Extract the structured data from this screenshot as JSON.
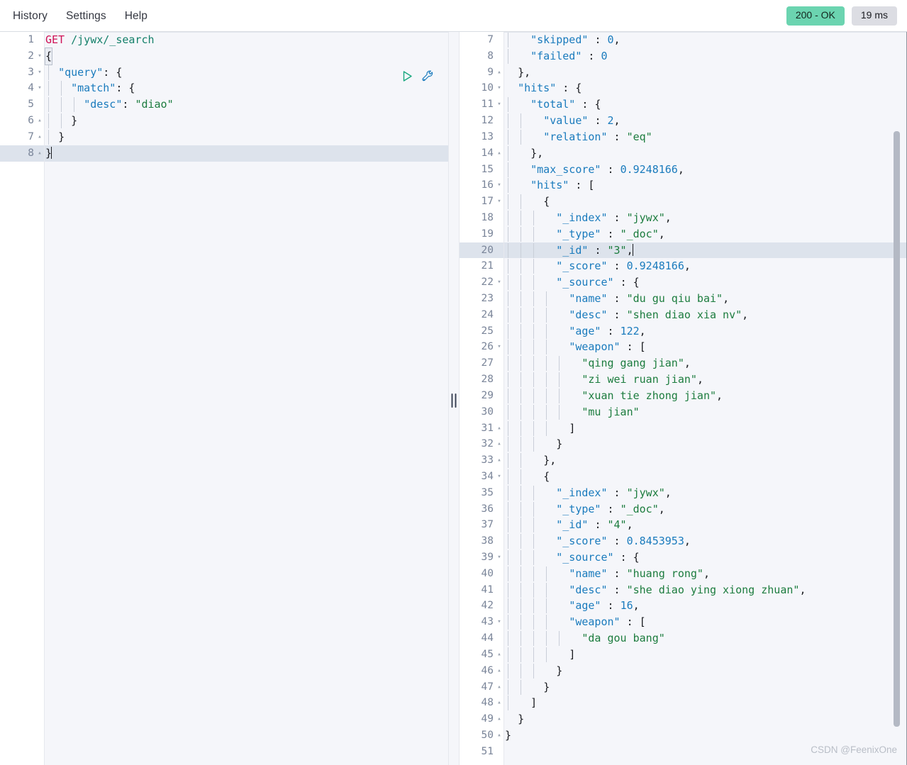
{
  "menu": {
    "items": [
      {
        "label": "History",
        "name": "menu-item-history"
      },
      {
        "label": "Settings",
        "name": "menu-item-settings"
      },
      {
        "label": "Help",
        "name": "menu-item-help"
      }
    ]
  },
  "status": {
    "code_label": "200 - OK",
    "time_label": "19 ms",
    "ok_color": "#6bd4b0",
    "time_bg": "#dcdde3"
  },
  "icons": {
    "play": "play-icon",
    "wrench": "wrench-icon",
    "splitter": "splitter-handle-icon"
  },
  "request": {
    "method": "GET",
    "path": "/jywx/_search",
    "active_line": 8,
    "lines": [
      {
        "n": 1,
        "fold": "",
        "indent": 0,
        "text": "GET /jywx/_search"
      },
      {
        "n": 2,
        "fold": "▾",
        "indent": 0,
        "text": "{"
      },
      {
        "n": 3,
        "fold": "▾",
        "indent": 1,
        "text": "  \"query\": {"
      },
      {
        "n": 4,
        "fold": "▾",
        "indent": 2,
        "text": "    \"match\": {"
      },
      {
        "n": 5,
        "fold": "",
        "indent": 3,
        "text": "      \"desc\": \"diao\""
      },
      {
        "n": 6,
        "fold": "▴",
        "indent": 2,
        "text": "    }"
      },
      {
        "n": 7,
        "fold": "▴",
        "indent": 1,
        "text": "  }"
      },
      {
        "n": 8,
        "fold": "▴",
        "indent": 0,
        "text": "}"
      }
    ],
    "query_body": {
      "query": {
        "match": {
          "desc": "diao"
        }
      }
    }
  },
  "response": {
    "active_line": 20,
    "first_visible_line": 7,
    "last_line": 51,
    "lines": [
      {
        "n": 7,
        "fold": "",
        "indent": 1,
        "text": "    \"skipped\" : 0,"
      },
      {
        "n": 8,
        "fold": "",
        "indent": 1,
        "text": "    \"failed\" : 0"
      },
      {
        "n": 9,
        "fold": "▴",
        "indent": 0,
        "text": "  },"
      },
      {
        "n": 10,
        "fold": "▾",
        "indent": 0,
        "text": "  \"hits\" : {"
      },
      {
        "n": 11,
        "fold": "▾",
        "indent": 1,
        "text": "    \"total\" : {"
      },
      {
        "n": 12,
        "fold": "",
        "indent": 2,
        "text": "      \"value\" : 2,"
      },
      {
        "n": 13,
        "fold": "",
        "indent": 2,
        "text": "      \"relation\" : \"eq\""
      },
      {
        "n": 14,
        "fold": "▴",
        "indent": 1,
        "text": "    },"
      },
      {
        "n": 15,
        "fold": "",
        "indent": 1,
        "text": "    \"max_score\" : 0.9248166,"
      },
      {
        "n": 16,
        "fold": "▾",
        "indent": 1,
        "text": "    \"hits\" : ["
      },
      {
        "n": 17,
        "fold": "▾",
        "indent": 2,
        "text": "      {"
      },
      {
        "n": 18,
        "fold": "",
        "indent": 3,
        "text": "        \"_index\" : \"jywx\","
      },
      {
        "n": 19,
        "fold": "",
        "indent": 3,
        "text": "        \"_type\" : \"_doc\","
      },
      {
        "n": 20,
        "fold": "",
        "indent": 3,
        "text": "        \"_id\" : \"3\","
      },
      {
        "n": 21,
        "fold": "",
        "indent": 3,
        "text": "        \"_score\" : 0.9248166,"
      },
      {
        "n": 22,
        "fold": "▾",
        "indent": 3,
        "text": "        \"_source\" : {"
      },
      {
        "n": 23,
        "fold": "",
        "indent": 4,
        "text": "          \"name\" : \"du gu qiu bai\","
      },
      {
        "n": 24,
        "fold": "",
        "indent": 4,
        "text": "          \"desc\" : \"shen diao xia nv\","
      },
      {
        "n": 25,
        "fold": "",
        "indent": 4,
        "text": "          \"age\" : 122,"
      },
      {
        "n": 26,
        "fold": "▾",
        "indent": 4,
        "text": "          \"weapon\" : ["
      },
      {
        "n": 27,
        "fold": "",
        "indent": 5,
        "text": "            \"qing gang jian\","
      },
      {
        "n": 28,
        "fold": "",
        "indent": 5,
        "text": "            \"zi wei ruan jian\","
      },
      {
        "n": 29,
        "fold": "",
        "indent": 5,
        "text": "            \"xuan tie zhong jian\","
      },
      {
        "n": 30,
        "fold": "",
        "indent": 5,
        "text": "            \"mu jian\""
      },
      {
        "n": 31,
        "fold": "▴",
        "indent": 4,
        "text": "          ]"
      },
      {
        "n": 32,
        "fold": "▴",
        "indent": 3,
        "text": "        }"
      },
      {
        "n": 33,
        "fold": "▴",
        "indent": 2,
        "text": "      },"
      },
      {
        "n": 34,
        "fold": "▾",
        "indent": 2,
        "text": "      {"
      },
      {
        "n": 35,
        "fold": "",
        "indent": 3,
        "text": "        \"_index\" : \"jywx\","
      },
      {
        "n": 36,
        "fold": "",
        "indent": 3,
        "text": "        \"_type\" : \"_doc\","
      },
      {
        "n": 37,
        "fold": "",
        "indent": 3,
        "text": "        \"_id\" : \"4\","
      },
      {
        "n": 38,
        "fold": "",
        "indent": 3,
        "text": "        \"_score\" : 0.8453953,"
      },
      {
        "n": 39,
        "fold": "▾",
        "indent": 3,
        "text": "        \"_source\" : {"
      },
      {
        "n": 40,
        "fold": "",
        "indent": 4,
        "text": "          \"name\" : \"huang rong\","
      },
      {
        "n": 41,
        "fold": "",
        "indent": 4,
        "text": "          \"desc\" : \"she diao ying xiong zhuan\","
      },
      {
        "n": 42,
        "fold": "",
        "indent": 4,
        "text": "          \"age\" : 16,"
      },
      {
        "n": 43,
        "fold": "▾",
        "indent": 4,
        "text": "          \"weapon\" : ["
      },
      {
        "n": 44,
        "fold": "",
        "indent": 5,
        "text": "            \"da gou bang\""
      },
      {
        "n": 45,
        "fold": "▴",
        "indent": 4,
        "text": "          ]"
      },
      {
        "n": 46,
        "fold": "▴",
        "indent": 3,
        "text": "        }"
      },
      {
        "n": 47,
        "fold": "▴",
        "indent": 2,
        "text": "      }"
      },
      {
        "n": 48,
        "fold": "▴",
        "indent": 1,
        "text": "    ]"
      },
      {
        "n": 49,
        "fold": "▴",
        "indent": 0,
        "text": "  }"
      },
      {
        "n": 50,
        "fold": "▴",
        "indent": 0,
        "text": "}"
      },
      {
        "n": 51,
        "fold": "",
        "indent": 0,
        "text": ""
      }
    ],
    "parsed": {
      "_shards": {
        "skipped": 0,
        "failed": 0
      },
      "hits": {
        "total": {
          "value": 2,
          "relation": "eq"
        },
        "max_score": 0.9248166,
        "hits": [
          {
            "_index": "jywx",
            "_type": "_doc",
            "_id": "3",
            "_score": 0.9248166,
            "_source": {
              "name": "du gu qiu bai",
              "desc": "shen diao xia nv",
              "age": 122,
              "weapon": [
                "qing gang jian",
                "zi wei ruan jian",
                "xuan tie zhong jian",
                "mu jian"
              ]
            }
          },
          {
            "_index": "jywx",
            "_type": "_doc",
            "_id": "4",
            "_score": 0.8453953,
            "_source": {
              "name": "huang rong",
              "desc": "she diao ying xiong zhuan",
              "age": 16,
              "weapon": [
                "da gou bang"
              ]
            }
          }
        ]
      }
    }
  },
  "watermark": {
    "text": "CSDN @FeenixOne"
  }
}
